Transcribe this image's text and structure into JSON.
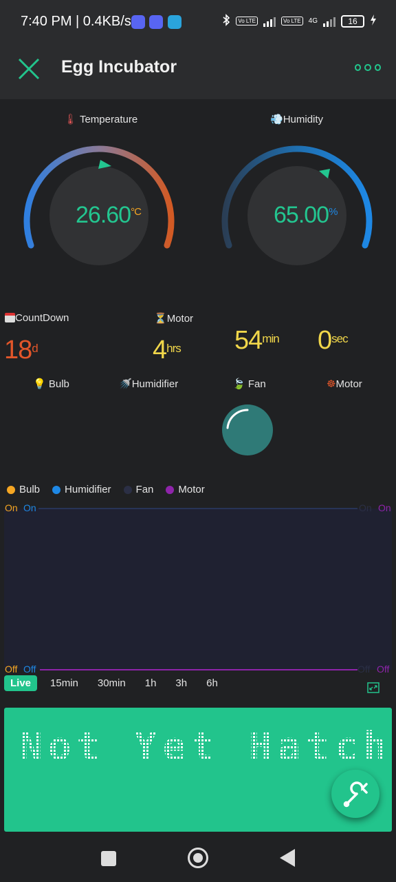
{
  "status_bar": {
    "time": "7:40 PM | 0.4KB/s",
    "sim1": "Vo LTE",
    "sim2": "Vo LTE",
    "network": "4G",
    "battery": "16"
  },
  "app_bar": {
    "title": "Egg Incubator"
  },
  "gauges": {
    "temperature": {
      "label": "Temperature",
      "icon": "thermometer-icon",
      "value": "26.60",
      "unit": "°C",
      "level": 0.6
    },
    "humidity": {
      "label": "Humidity",
      "icon": "wind-icon",
      "value": "65.00",
      "unit": "%",
      "level": 0.65
    }
  },
  "countdown": {
    "label": "CountDown",
    "value": "18",
    "unit": "d"
  },
  "motor_timer": {
    "label": "Motor",
    "hours": "4",
    "hours_unit": "hrs",
    "minutes": "54",
    "minutes_unit": "min",
    "seconds": "0",
    "seconds_unit": "sec"
  },
  "buttons": [
    {
      "label": "Bulb",
      "icon": "bulb-icon"
    },
    {
      "label": "Humidifier",
      "icon": "shower-icon"
    },
    {
      "label": "Fan",
      "icon": "leaf-icon"
    },
    {
      "label": "Motor",
      "icon": "wheel-icon"
    }
  ],
  "chart": {
    "legend": [
      {
        "label": "Bulb",
        "color": "#f5a623"
      },
      {
        "label": "Humidifier",
        "color": "#1e88e5"
      },
      {
        "label": "Fan",
        "color": "#2b2f45"
      },
      {
        "label": "Motor",
        "color": "#8e24aa"
      }
    ],
    "left_top": [
      "On",
      "On"
    ],
    "right_top": [
      "On",
      "On"
    ],
    "left_bottom": [
      "Off",
      "Off"
    ],
    "right_bottom": [
      "Off",
      "Off"
    ],
    "ranges": [
      "Live",
      "15min",
      "30min",
      "1h",
      "3h",
      "6h"
    ]
  },
  "chart_data": {
    "type": "line",
    "series": [
      {
        "name": "Bulb",
        "values": [
          "Off"
        ]
      },
      {
        "name": "Humidifier",
        "values": [
          "On"
        ]
      },
      {
        "name": "Fan",
        "values": [
          "Off"
        ]
      },
      {
        "name": "Motor",
        "values": [
          "Off"
        ]
      }
    ],
    "ylim": [
      "Off",
      "On"
    ]
  },
  "lcd": {
    "text": "Not Yet Hatch"
  },
  "colors": {
    "accent": "#22c48c",
    "countdown": "#e2562a",
    "timer": "#f0d64a"
  }
}
